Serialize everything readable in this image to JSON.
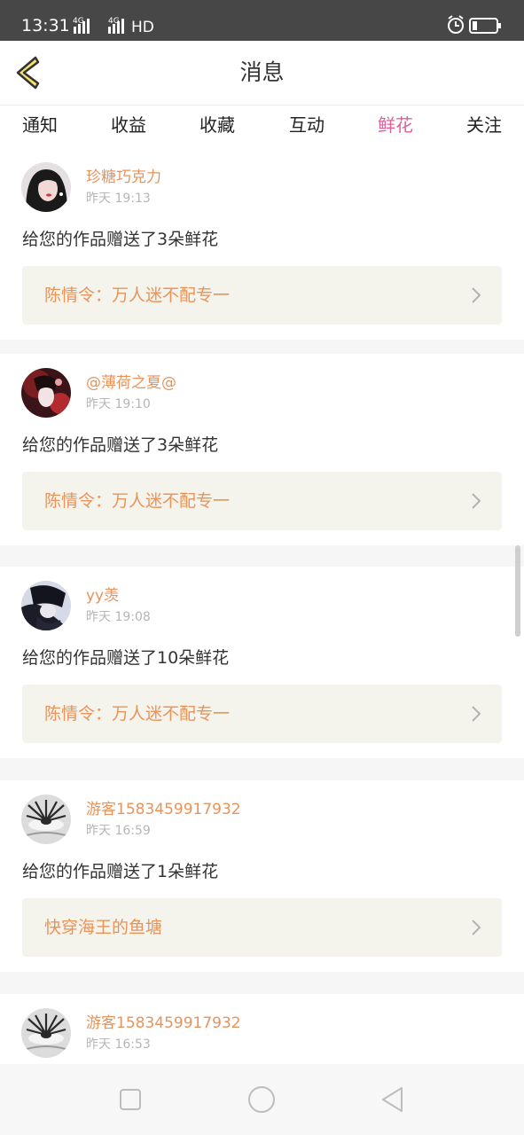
{
  "status_bar": {
    "time": "13:31",
    "network_1": "4G",
    "network_2": "4G",
    "hd_label": "HD",
    "icons": [
      "signal-icon",
      "alarm-icon",
      "battery-icon"
    ]
  },
  "header": {
    "title": "消息",
    "back_icon": "chevron-left-icon"
  },
  "tabs": {
    "items": [
      {
        "label": "通知",
        "active": false
      },
      {
        "label": "收益",
        "active": false
      },
      {
        "label": "收藏",
        "active": false
      },
      {
        "label": "互动",
        "active": false
      },
      {
        "label": "鲜花",
        "active": true
      },
      {
        "label": "关注",
        "active": false
      }
    ]
  },
  "messages": [
    {
      "username": "珍糖巧克力",
      "time": "昨天 19:13",
      "text": "给您的作品赠送了3朵鲜花",
      "work_title": "陈情令：万人迷不配专一"
    },
    {
      "username": "@薄荷之夏@",
      "time": "昨天 19:10",
      "text": "给您的作品赠送了3朵鲜花",
      "work_title": "陈情令：万人迷不配专一"
    },
    {
      "username": "yy羡",
      "time": "昨天 19:08",
      "text": "给您的作品赠送了10朵鲜花",
      "work_title": "陈情令：万人迷不配专一"
    },
    {
      "username": "游客1583459917932",
      "time": "昨天 16:59",
      "text": "给您的作品赠送了1朵鲜花",
      "work_title": "快穿海王的鱼塘"
    },
    {
      "username": "游客1583459917932",
      "time": "昨天 16:53",
      "text": "",
      "work_title": ""
    }
  ],
  "nav_bar": {
    "icons": [
      "recent-apps-icon",
      "home-icon",
      "back-icon"
    ]
  },
  "colors": {
    "status_bar_bg": "#474747",
    "accent_pink": "#e0609b",
    "username_orange": "#e8935a",
    "work_box_bg": "#f5f4ec",
    "separator_bg": "#f6f6f6",
    "back_chevron_fill": "#f4e46c"
  }
}
